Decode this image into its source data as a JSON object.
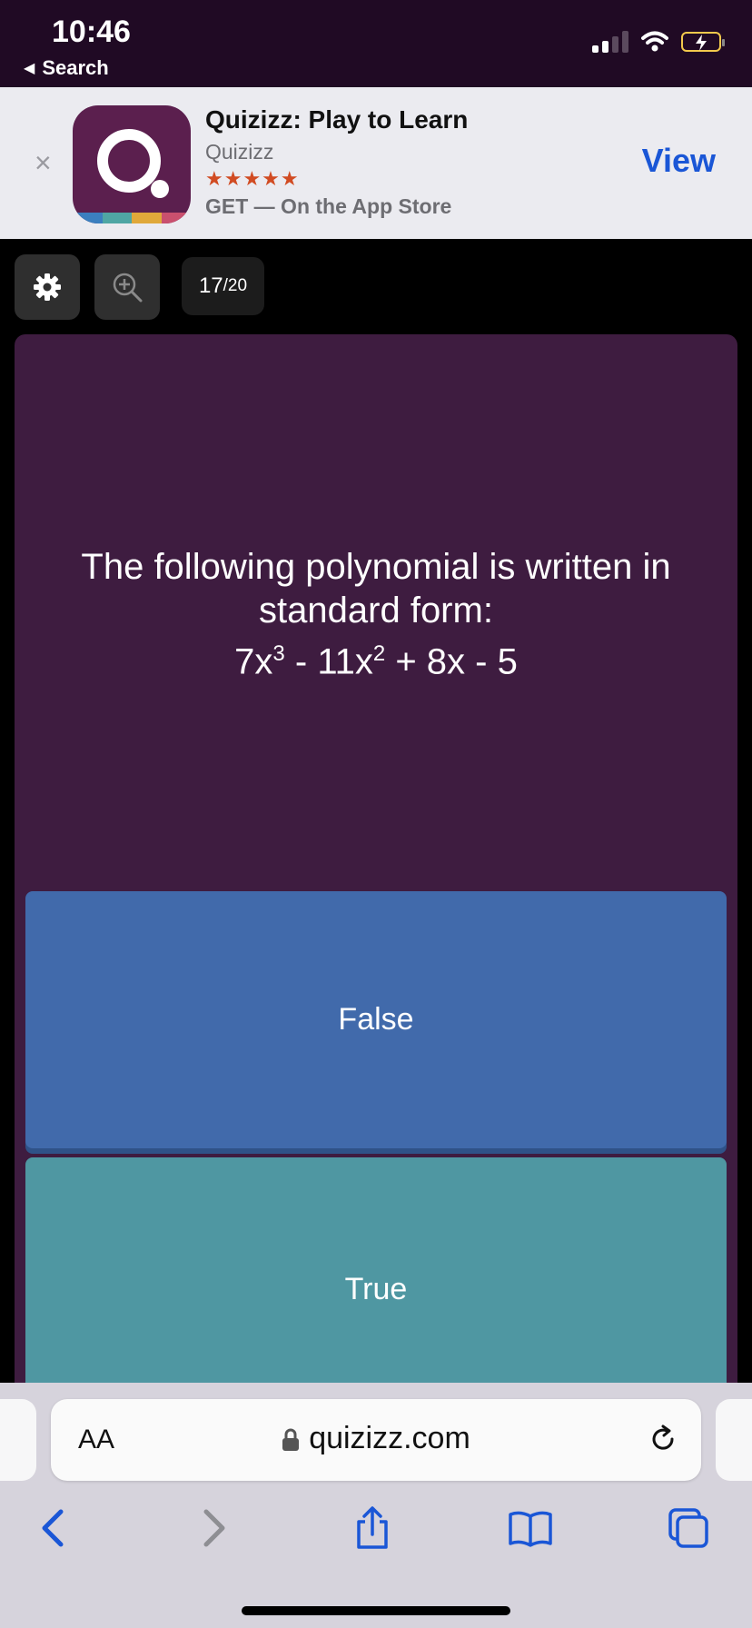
{
  "status_bar": {
    "time": "10:46",
    "back_label": "Search"
  },
  "app_banner": {
    "app_name": "Quizizz: Play to Learn",
    "developer": "Quizizz",
    "stars": "★★★★★",
    "subtitle": "GET — On the App Store",
    "view_label": "View",
    "close_label": "×",
    "colors": {
      "icon_bg": "#5b1f4e",
      "strip": [
        "#3b7fbf",
        "#4fa6a4",
        "#e0a83a",
        "#c9506e"
      ]
    }
  },
  "quiz": {
    "progress_current": "17",
    "progress_total": "/20",
    "question_line1": "The following polynomial is written in",
    "question_line2": "standard form:",
    "expr": {
      "t1": "7x",
      "e1": "3",
      "t2": " - 11x",
      "e2": "2",
      "t3": " + 8x - 5"
    },
    "answers": [
      {
        "label": "False",
        "color": "#416aab"
      },
      {
        "label": "True",
        "color": "#4f97a2"
      }
    ],
    "card_color": "#3e1c40"
  },
  "browser": {
    "text_size_label": "AA",
    "url": "quizizz.com",
    "accent": "#1a56d6"
  }
}
